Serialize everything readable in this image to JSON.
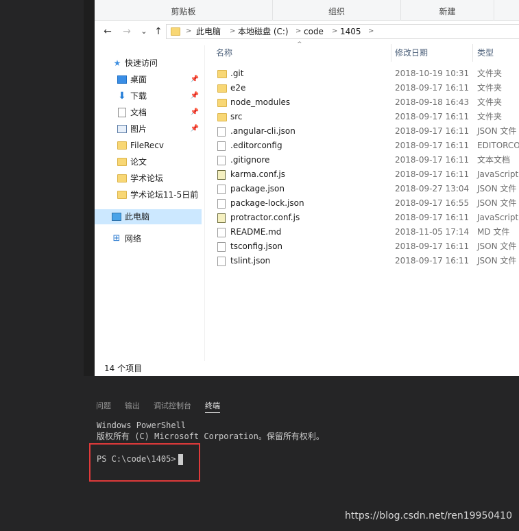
{
  "ribbon": {
    "groups": [
      "剪贴板",
      "组织",
      "新建"
    ]
  },
  "address": {
    "back_icon": "←",
    "forward_icon": "→",
    "dropdown_icon": "⌄",
    "up_icon": "↑",
    "crumbs": [
      "此电脑",
      "本地磁盘 (C:)",
      "code",
      "1405"
    ]
  },
  "nav": {
    "quick_access": "快速访问",
    "items": [
      {
        "label": "桌面",
        "icon": "desktop-icon",
        "pinned": true
      },
      {
        "label": "下载",
        "icon": "download-icon",
        "pinned": true
      },
      {
        "label": "文档",
        "icon": "document-icon",
        "pinned": true
      },
      {
        "label": "图片",
        "icon": "picture-icon",
        "pinned": true
      },
      {
        "label": "FileRecv",
        "icon": "folder-icon",
        "pinned": false
      },
      {
        "label": "论文",
        "icon": "folder-icon",
        "pinned": false
      },
      {
        "label": "学术论坛",
        "icon": "folder-icon",
        "pinned": false
      },
      {
        "label": "学术论坛11-5日前",
        "icon": "folder-icon",
        "pinned": false
      }
    ],
    "this_pc": "此电脑",
    "network": "网络"
  },
  "columns": {
    "name": "名称",
    "date": "修改日期",
    "type": "类型"
  },
  "files": [
    {
      "name": ".git",
      "date": "2018-10-19 10:31",
      "type": "文件夹",
      "kind": "folder"
    },
    {
      "name": "e2e",
      "date": "2018-09-17 16:11",
      "type": "文件夹",
      "kind": "folder"
    },
    {
      "name": "node_modules",
      "date": "2018-09-18 16:43",
      "type": "文件夹",
      "kind": "folder"
    },
    {
      "name": "src",
      "date": "2018-09-17 16:11",
      "type": "文件夹",
      "kind": "folder"
    },
    {
      "name": ".angular-cli.json",
      "date": "2018-09-17 16:11",
      "type": "JSON 文件",
      "kind": "file"
    },
    {
      "name": ".editorconfig",
      "date": "2018-09-17 16:11",
      "type": "EDITORCONFIG",
      "kind": "file"
    },
    {
      "name": ".gitignore",
      "date": "2018-09-17 16:11",
      "type": "文本文档",
      "kind": "file"
    },
    {
      "name": "karma.conf.js",
      "date": "2018-09-17 16:11",
      "type": "JavaScript",
      "kind": "js"
    },
    {
      "name": "package.json",
      "date": "2018-09-27 13:04",
      "type": "JSON 文件",
      "kind": "file"
    },
    {
      "name": "package-lock.json",
      "date": "2018-09-17 16:55",
      "type": "JSON 文件",
      "kind": "file"
    },
    {
      "name": "protractor.conf.js",
      "date": "2018-09-17 16:11",
      "type": "JavaScript",
      "kind": "js"
    },
    {
      "name": "README.md",
      "date": "2018-11-05 17:14",
      "type": "MD 文件",
      "kind": "file"
    },
    {
      "name": "tsconfig.json",
      "date": "2018-09-17 16:11",
      "type": "JSON 文件",
      "kind": "file"
    },
    {
      "name": "tslint.json",
      "date": "2018-09-17 16:11",
      "type": "JSON 文件",
      "kind": "file"
    }
  ],
  "status": "14 个项目",
  "panel": {
    "tabs": [
      "问题",
      "输出",
      "调试控制台",
      "终端"
    ],
    "active_tab": "终端"
  },
  "terminal": {
    "line1": "Windows PowerShell",
    "line2": "版权所有 (C) Microsoft Corporation。保留所有权利。",
    "prompt": "PS C:\\code\\1405> "
  },
  "watermark": "https://blog.csdn.net/ren19950410",
  "colors": {
    "highlight_box": "#e03a3a",
    "nav_selected": "#cce8ff",
    "terminal_bg": "#252526"
  }
}
